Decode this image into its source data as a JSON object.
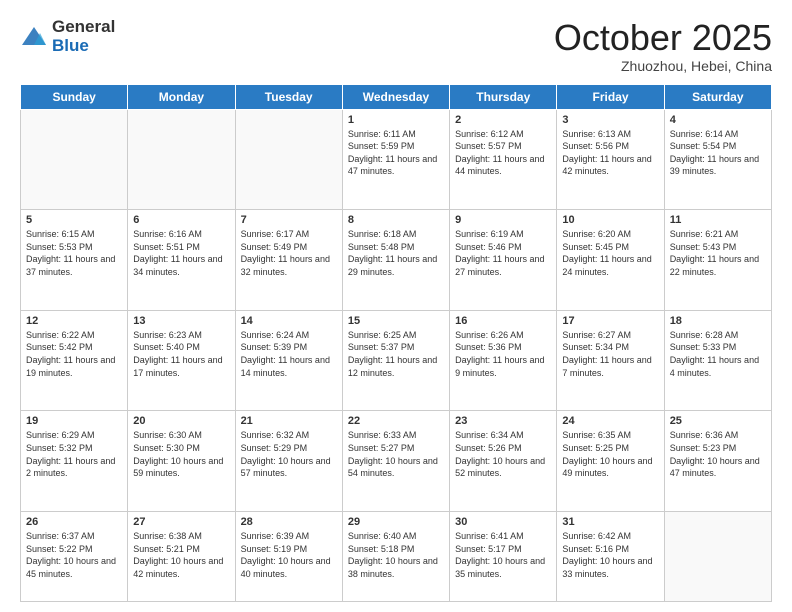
{
  "header": {
    "logo_general": "General",
    "logo_blue": "Blue",
    "month": "October 2025",
    "location": "Zhuozhou, Hebei, China"
  },
  "days_of_week": [
    "Sunday",
    "Monday",
    "Tuesday",
    "Wednesday",
    "Thursday",
    "Friday",
    "Saturday"
  ],
  "weeks": [
    [
      {
        "num": "",
        "info": ""
      },
      {
        "num": "",
        "info": ""
      },
      {
        "num": "",
        "info": ""
      },
      {
        "num": "1",
        "info": "Sunrise: 6:11 AM\nSunset: 5:59 PM\nDaylight: 11 hours and 47 minutes."
      },
      {
        "num": "2",
        "info": "Sunrise: 6:12 AM\nSunset: 5:57 PM\nDaylight: 11 hours and 44 minutes."
      },
      {
        "num": "3",
        "info": "Sunrise: 6:13 AM\nSunset: 5:56 PM\nDaylight: 11 hours and 42 minutes."
      },
      {
        "num": "4",
        "info": "Sunrise: 6:14 AM\nSunset: 5:54 PM\nDaylight: 11 hours and 39 minutes."
      }
    ],
    [
      {
        "num": "5",
        "info": "Sunrise: 6:15 AM\nSunset: 5:53 PM\nDaylight: 11 hours and 37 minutes."
      },
      {
        "num": "6",
        "info": "Sunrise: 6:16 AM\nSunset: 5:51 PM\nDaylight: 11 hours and 34 minutes."
      },
      {
        "num": "7",
        "info": "Sunrise: 6:17 AM\nSunset: 5:49 PM\nDaylight: 11 hours and 32 minutes."
      },
      {
        "num": "8",
        "info": "Sunrise: 6:18 AM\nSunset: 5:48 PM\nDaylight: 11 hours and 29 minutes."
      },
      {
        "num": "9",
        "info": "Sunrise: 6:19 AM\nSunset: 5:46 PM\nDaylight: 11 hours and 27 minutes."
      },
      {
        "num": "10",
        "info": "Sunrise: 6:20 AM\nSunset: 5:45 PM\nDaylight: 11 hours and 24 minutes."
      },
      {
        "num": "11",
        "info": "Sunrise: 6:21 AM\nSunset: 5:43 PM\nDaylight: 11 hours and 22 minutes."
      }
    ],
    [
      {
        "num": "12",
        "info": "Sunrise: 6:22 AM\nSunset: 5:42 PM\nDaylight: 11 hours and 19 minutes."
      },
      {
        "num": "13",
        "info": "Sunrise: 6:23 AM\nSunset: 5:40 PM\nDaylight: 11 hours and 17 minutes."
      },
      {
        "num": "14",
        "info": "Sunrise: 6:24 AM\nSunset: 5:39 PM\nDaylight: 11 hours and 14 minutes."
      },
      {
        "num": "15",
        "info": "Sunrise: 6:25 AM\nSunset: 5:37 PM\nDaylight: 11 hours and 12 minutes."
      },
      {
        "num": "16",
        "info": "Sunrise: 6:26 AM\nSunset: 5:36 PM\nDaylight: 11 hours and 9 minutes."
      },
      {
        "num": "17",
        "info": "Sunrise: 6:27 AM\nSunset: 5:34 PM\nDaylight: 11 hours and 7 minutes."
      },
      {
        "num": "18",
        "info": "Sunrise: 6:28 AM\nSunset: 5:33 PM\nDaylight: 11 hours and 4 minutes."
      }
    ],
    [
      {
        "num": "19",
        "info": "Sunrise: 6:29 AM\nSunset: 5:32 PM\nDaylight: 11 hours and 2 minutes."
      },
      {
        "num": "20",
        "info": "Sunrise: 6:30 AM\nSunset: 5:30 PM\nDaylight: 10 hours and 59 minutes."
      },
      {
        "num": "21",
        "info": "Sunrise: 6:32 AM\nSunset: 5:29 PM\nDaylight: 10 hours and 57 minutes."
      },
      {
        "num": "22",
        "info": "Sunrise: 6:33 AM\nSunset: 5:27 PM\nDaylight: 10 hours and 54 minutes."
      },
      {
        "num": "23",
        "info": "Sunrise: 6:34 AM\nSunset: 5:26 PM\nDaylight: 10 hours and 52 minutes."
      },
      {
        "num": "24",
        "info": "Sunrise: 6:35 AM\nSunset: 5:25 PM\nDaylight: 10 hours and 49 minutes."
      },
      {
        "num": "25",
        "info": "Sunrise: 6:36 AM\nSunset: 5:23 PM\nDaylight: 10 hours and 47 minutes."
      }
    ],
    [
      {
        "num": "26",
        "info": "Sunrise: 6:37 AM\nSunset: 5:22 PM\nDaylight: 10 hours and 45 minutes."
      },
      {
        "num": "27",
        "info": "Sunrise: 6:38 AM\nSunset: 5:21 PM\nDaylight: 10 hours and 42 minutes."
      },
      {
        "num": "28",
        "info": "Sunrise: 6:39 AM\nSunset: 5:19 PM\nDaylight: 10 hours and 40 minutes."
      },
      {
        "num": "29",
        "info": "Sunrise: 6:40 AM\nSunset: 5:18 PM\nDaylight: 10 hours and 38 minutes."
      },
      {
        "num": "30",
        "info": "Sunrise: 6:41 AM\nSunset: 5:17 PM\nDaylight: 10 hours and 35 minutes."
      },
      {
        "num": "31",
        "info": "Sunrise: 6:42 AM\nSunset: 5:16 PM\nDaylight: 10 hours and 33 minutes."
      },
      {
        "num": "",
        "info": ""
      }
    ]
  ]
}
